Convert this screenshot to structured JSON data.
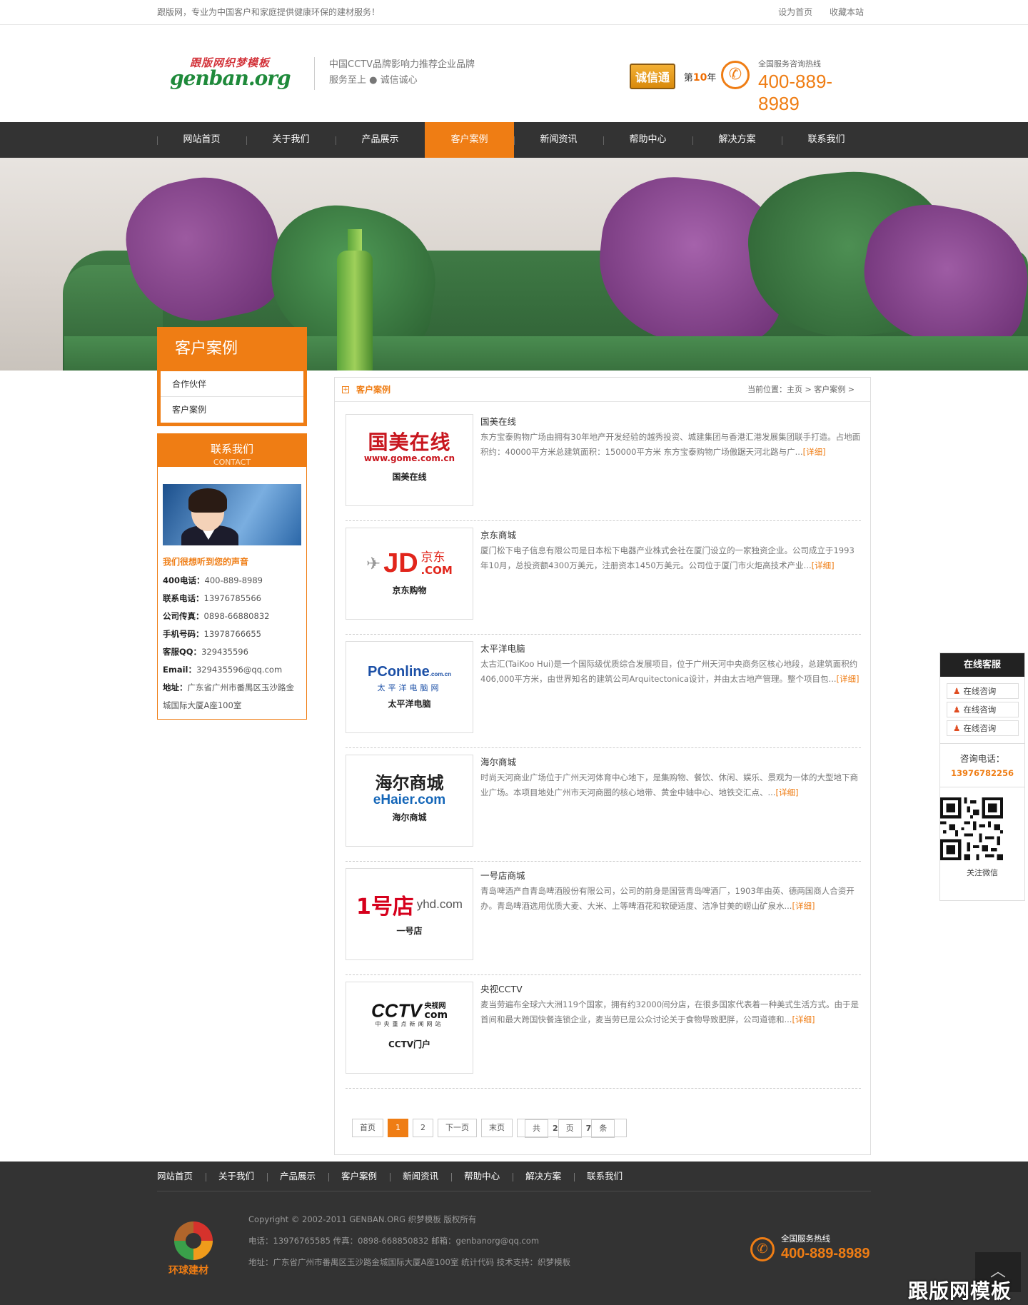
{
  "topbar": {
    "tagline": "跟版网，专业为中国客户和家庭提供健康环保的建材服务！",
    "set_home": "设为首页",
    "bookmark": "收藏本站"
  },
  "header": {
    "logo_top": "跟版网织梦模板",
    "logo_main": "genban.org",
    "slogan_1": "中国CCTV品牌影响力推荐企业品牌",
    "slogan_2": "服务至上 ● 诚信诚心",
    "badge": "诚信通",
    "year_prefix": "第",
    "year_num": "10",
    "year_suffix": "年",
    "hotline_label": "全国服务咨询热线",
    "hotline": "400-889-8989"
  },
  "nav": [
    "网站首页",
    "关于我们",
    "产品展示",
    "客户案例",
    "新闻资讯",
    "帮助中心",
    "解决方案",
    "联系我们"
  ],
  "nav_active": "客户案例",
  "sidebar": {
    "title": "客户案例",
    "items": [
      "合作伙伴",
      "客户案例"
    ]
  },
  "contact": {
    "title": "联系我们",
    "title_en": "CONTACT",
    "voice": "我们很想听到您的声音",
    "rows": [
      {
        "k": "400电话：",
        "v": "400-889-8989"
      },
      {
        "k": "联系电话：",
        "v": "13976785566"
      },
      {
        "k": "公司传真：",
        "v": "0898-66880832"
      },
      {
        "k": "手机号码：",
        "v": "13978766655"
      },
      {
        "k": "客服QQ：",
        "v": "329435596"
      },
      {
        "k": "Email：",
        "v": "329435596@qq.com"
      }
    ],
    "addr_k": "地址：",
    "addr_v": "广东省广州市番禺区玉沙路金城国际大厦A座100室"
  },
  "main": {
    "title": "客户案例",
    "crumb": "当前位置：主页 > 客户案例 >",
    "more": "[详细]",
    "cases": [
      {
        "caption": "国美在线",
        "name": "国美在线",
        "desc": "东方宝泰购物广场由拥有30年地产开发经验的越秀投资、城建集团与香港汇港发展集团联手打造。占地面积约：40000平方米总建筑面积：150000平方米 东方宝泰购物广场傲踞天河北路与广..."
      },
      {
        "caption": "京东购物",
        "name": "京东商城",
        "desc": "厦门松下电子信息有限公司是日本松下电器产业株式会社在厦门设立的一家独资企业。公司成立于1993年10月，总投资额4300万美元，注册资本1450万美元。公司位于厦门市火炬高技术产业..."
      },
      {
        "caption": "太平洋电脑",
        "name": "太平洋电脑",
        "desc": "太古汇(TaiKoo Hui)是一个国际级优质综合发展项目，位于广州天河中央商务区核心地段，总建筑面积约406,000平方米，由世界知名的建筑公司Arquitectonica设计，并由太古地产管理。整个项目包..."
      },
      {
        "caption": "海尔商城",
        "name": "海尔商城",
        "desc": "时尚天河商业广场位于广州天河体育中心地下，是集购物、餐饮、休闲、娱乐、景观为一体的大型地下商业广场。本项目地处广州市天河商圈的核心地带、黄金中轴中心、地铁交汇点、..."
      },
      {
        "caption": "一号店",
        "name": "一号店商城",
        "desc": "青岛啤酒产自青岛啤酒股份有限公司，公司的前身是国营青岛啤酒厂，1903年由英、德两国商人合资开办。青岛啤酒选用优质大麦、大米、上等啤酒花和软硬适度、洁净甘美的崂山矿泉水..."
      },
      {
        "caption": "CCTV门户",
        "name": "央视CCTV",
        "desc": "麦当劳遍布全球六大洲119个国家，拥有约32000间分店，在很多国家代表着一种美式生活方式。由于是首间和最大跨国快餐连锁企业，麦当劳已是公众讨论关于食物导致肥胖，公司道德和..."
      }
    ],
    "logos": {
      "gome_cn": "国美在线",
      "gome_url": "www.gome.com.cn",
      "jd_cn": "京东",
      "jd_dot": ".COM",
      "pc_top": "PConline",
      "pc_small": ".com.cn",
      "pc_cn": "太平洋电脑网",
      "haier_cn": "海尔商城",
      "haier_en": "eHaier.com",
      "yhd_num": "1号店",
      "yhd_en": "yhd.com",
      "cctv_en": "CCTV",
      "cctv_cn1": "央视网",
      "cctv_com": "com",
      "cctv_sub": "中央重点新闻网站"
    },
    "pager": [
      "首页",
      "1",
      "2",
      "下一页",
      "末页"
    ],
    "pager_total_prefix": "共 ",
    "pager_total_pages": "2",
    "pager_total_mid": "页",
    "pager_total_items": "7",
    "pager_total_suffix": "条"
  },
  "service": {
    "title": "在线客服",
    "qq": [
      "在线咨询",
      "在线咨询",
      "在线咨询"
    ],
    "tel_label": "咨询电话：",
    "tel": "13976782256",
    "qr_label": "关注微信"
  },
  "footer": {
    "nav": [
      "网站首页",
      "关于我们",
      "产品展示",
      "客户案例",
      "新闻资讯",
      "帮助中心",
      "解决方案",
      "联系我们"
    ],
    "brand": "环球建材",
    "copyright": "Copyright © 2002-2011 GENBAN.ORG 织梦模板 版权所有",
    "contact": "电话：13976765585 传真：0898-668850832 邮箱：genbanorg@qq.com",
    "address": "地址：广东省广州市番禺区玉沙路金城国际大厦A座100室 统计代码 技术支持：织梦模板",
    "hotline_label": "全国服务热线",
    "hotline": "400-889-8989",
    "watermark": "跟版网模板"
  },
  "colors": {
    "accent": "#ef7d14",
    "nav_bg": "#333333",
    "footer_bg": "#333333"
  }
}
